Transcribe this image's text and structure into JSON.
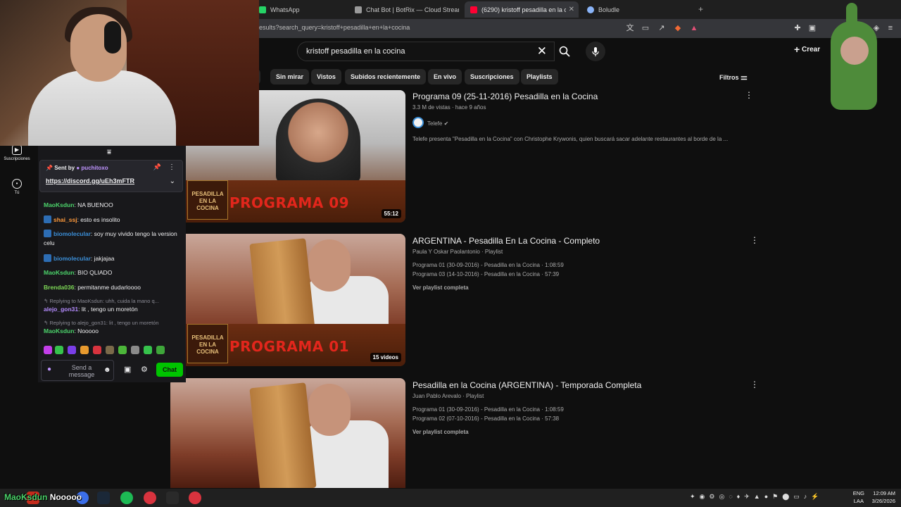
{
  "browser": {
    "tabs": [
      {
        "label": "WhatsApp",
        "color": "#25d366"
      },
      {
        "label": "Chat Bot | BotRix — Cloud Streaming",
        "color": "#9a9a9a"
      },
      {
        "label": "(6290) kristoff pesadilla en la co",
        "color": "#ff0033"
      },
      {
        "label": "Boludle",
        "color": "#8ab4f8"
      }
    ],
    "url": "esults?search_query=kristoff+pesadilla+en+la+cocina"
  },
  "youtube": {
    "search_query": "kristoff pesadilla en la cocina",
    "create_label": "Crear",
    "filters_label": "Filtros",
    "chips": [
      "Sin mirar",
      "Vistos",
      "Subidos recientemente",
      "En vivo",
      "Suscripciones",
      "Playlists"
    ],
    "nav": [
      {
        "label": "Suscripciones"
      },
      {
        "label": "Tú"
      }
    ],
    "results": [
      {
        "title": "Programa 09 (25-11-2016) Pesadilla en la Cocina",
        "meta": "3.3 M de vistas · hace 9 años",
        "channel": "Telefe",
        "description": "Telefe presenta \"Pesadilla en la Cocina\" con Christophe Krywonis, quien buscará sacar adelante restaurantes al borde de la ...",
        "duration": "55:12",
        "banner": "PROGRAMA 09",
        "logo_text": "PESADILLA EN LA COCINA"
      },
      {
        "title": "ARGENTINA - Pesadilla En La Cocina - Completo",
        "meta": "Paula Y Oskar Paolantonio · Playlist",
        "items": [
          "Programa 01 (30-09-2016) - Pesadilla en la Cocina · 1:08:59",
          "Programa 03 (14-10-2016) - Pesadilla en la Cocina · 57:39"
        ],
        "view_all": "Ver playlist completa",
        "duration": "15 videos",
        "banner": "PROGRAMA 01",
        "logo_text": "PESADILLA EN LA COCINA"
      },
      {
        "title": "Pesadilla en la Cocina (ARGENTINA) - Temporada Completa",
        "meta": "Juan Pablo Arevalo · Playlist",
        "items": [
          "Programa 01 (30-09-2016) - Pesadilla en la Cocina · 1:08:59",
          "Programa 02 (07-10-2016) - Pesadilla en la Cocina · 57:38"
        ],
        "view_all": "Ver playlist completa"
      }
    ]
  },
  "chat": {
    "pinned_sent_by": "Sent by",
    "pinned_user": "puchitoxo",
    "pinned_link": "https://discord.gg/uEh3mFTR",
    "messages": [
      {
        "user": "MaoKsdun",
        "color": "#4cd46b",
        "text": ": NA BUENOO",
        "badge": false
      },
      {
        "user": "shai_ssj",
        "color": "#ff9a3c",
        "text": ": esto es insolito",
        "badge": true
      },
      {
        "user": "biomolecular",
        "color": "#3b8fd8",
        "text": ": soy muy vivido tengo la version celu",
        "badge": true
      },
      {
        "user": "biomolecular",
        "color": "#3b8fd8",
        "text": ": jakjajaa",
        "badge": true
      },
      {
        "user": "MaoKsdun",
        "color": "#4cd46b",
        "text": ": BIO QLIADO",
        "badge": false
      },
      {
        "user": "Brenda036",
        "color": "#7ed957",
        "text": ": permitanme dudarloooo",
        "badge": false
      },
      {
        "reply": "Replying to MaoKsdun: uhh, cuida la mano q..."
      },
      {
        "user": "alejo_gon31",
        "color": "#b58cff",
        "text": ": lit , tengo un moretón",
        "badge": false
      },
      {
        "reply": "Replying to alejo_gon31: lit , tengo un moretón"
      },
      {
        "user": "MaoKsdun",
        "color": "#4cd46b",
        "text": ": Nooooo",
        "badge": false
      }
    ],
    "input_placeholder": "Send a message",
    "send_label": "Chat"
  },
  "overlay": {
    "user": "MaoKsdun",
    "text": "Nooooo"
  },
  "taskbar": {
    "lang_top": "ENG",
    "lang_bottom": "LAA",
    "time": "12:09 AM",
    "date": "3/26/2026"
  }
}
